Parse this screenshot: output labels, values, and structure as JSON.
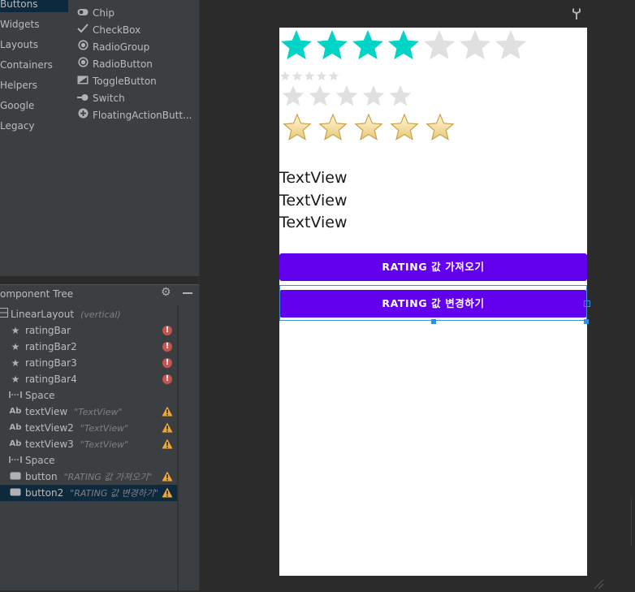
{
  "palette": {
    "categories": [
      "Buttons",
      "Widgets",
      "Layouts",
      "Containers",
      "Helpers",
      "Google",
      "Legacy"
    ],
    "selected_category": "Buttons",
    "items": [
      {
        "label": "Chip",
        "icon": "chip-icon"
      },
      {
        "label": "CheckBox",
        "icon": "checkbox-icon"
      },
      {
        "label": "RadioGroup",
        "icon": "radio-group-icon"
      },
      {
        "label": "RadioButton",
        "icon": "radio-button-icon"
      },
      {
        "label": "ToggleButton",
        "icon": "toggle-button-icon"
      },
      {
        "label": "Switch",
        "icon": "switch-icon"
      },
      {
        "label": "FloatingActionButt...",
        "icon": "fab-icon"
      }
    ]
  },
  "tree": {
    "title": "omponent Tree",
    "root": {
      "label": "LinearLayout",
      "hint": "(vertical)"
    },
    "rows": [
      {
        "label": "ratingBar",
        "hint": "",
        "icon": "star-icon",
        "status": "error"
      },
      {
        "label": "ratingBar2",
        "hint": "",
        "icon": "star-icon",
        "status": "error"
      },
      {
        "label": "ratingBar3",
        "hint": "",
        "icon": "star-icon",
        "status": "error"
      },
      {
        "label": "ratingBar4",
        "hint": "",
        "icon": "star-icon",
        "status": "error"
      },
      {
        "label": "Space",
        "hint": "",
        "icon": "space-icon",
        "status": ""
      },
      {
        "label": "textView",
        "hint": "\"TextView\"",
        "icon": "textview-icon",
        "status": "warning"
      },
      {
        "label": "textView2",
        "hint": "\"TextView\"",
        "icon": "textview-icon",
        "status": "warning"
      },
      {
        "label": "textView3",
        "hint": "\"TextView\"",
        "icon": "textview-icon",
        "status": "warning"
      },
      {
        "label": "Space",
        "hint": "",
        "icon": "space-icon",
        "status": ""
      },
      {
        "label": "button",
        "hint": "\"RATING 값 가져오기\"",
        "icon": "button-icon",
        "status": "warning"
      },
      {
        "label": "button2",
        "hint": "\"RATING 값 변경하기\"",
        "icon": "button-icon",
        "status": "warning"
      }
    ],
    "selected_row": "button2"
  },
  "preview": {
    "rating_bars": [
      {
        "name": "ratingBar",
        "num_stars": 7,
        "rating": 4,
        "style": "large-material"
      },
      {
        "name": "ratingBar2",
        "num_stars": 5,
        "rating": 0,
        "style": "small"
      },
      {
        "name": "ratingBar3",
        "num_stars": 5,
        "rating": 0,
        "style": "medium"
      },
      {
        "name": "ratingBar4",
        "num_stars": 5,
        "rating": 5,
        "style": "gold"
      }
    ],
    "text_views": [
      "TextView",
      "TextView",
      "TextView"
    ],
    "buttons": [
      "RATING 값 가져오기",
      "RATING 값 변경하기"
    ]
  },
  "colors": {
    "star_filled": "#00d4c6",
    "star_empty": "#e0e0e0",
    "button_bg": "#6200ee",
    "error": "#c75450",
    "warning": "#f0a732",
    "selection": "#3d8fd6"
  }
}
